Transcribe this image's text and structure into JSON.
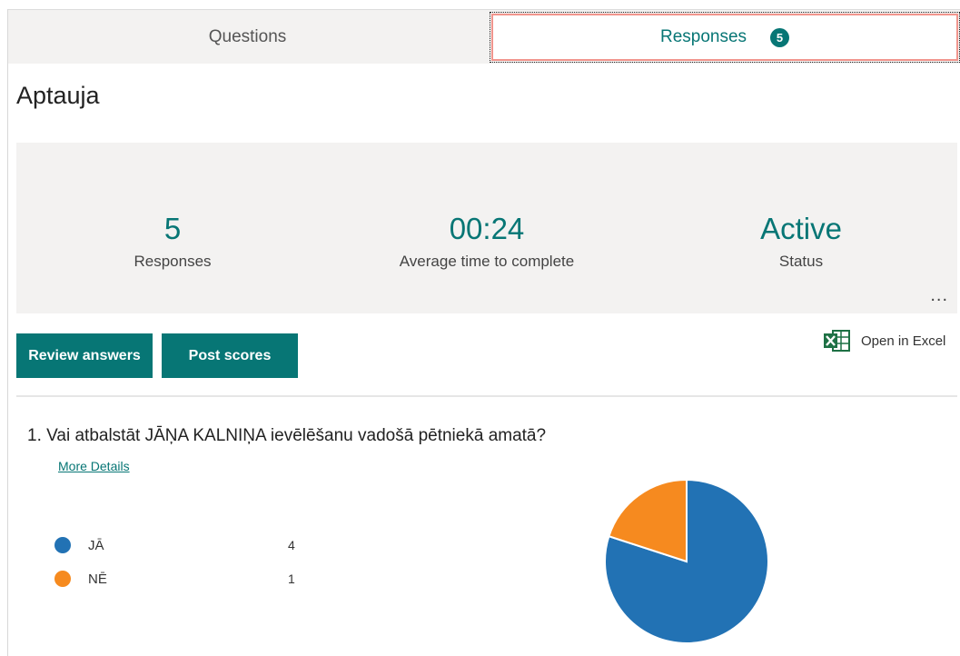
{
  "tabs": {
    "questions_label": "Questions",
    "responses_label": "Responses",
    "responses_badge": "5"
  },
  "form": {
    "title": "Aptauja"
  },
  "summary": {
    "responses": {
      "value": "5",
      "label": "Responses"
    },
    "avg_time": {
      "value": "00:24",
      "label": "Average time to complete"
    },
    "status": {
      "value": "Active",
      "label": "Status"
    },
    "more_label": "..."
  },
  "actions": {
    "review_label": "Review answers",
    "post_scores_label": "Post scores",
    "open_excel_label": "Open in Excel"
  },
  "question": {
    "number": "1.",
    "text": "Vai atbalstāt JĀŅA KALNIŅA ievēlēšanu vadošā pētniekā amatā?",
    "more_details": "More Details"
  },
  "chart_data": {
    "type": "pie",
    "categories": [
      "JĀ",
      "NĒ"
    ],
    "values": [
      4,
      1
    ],
    "colors": [
      "#2272b4",
      "#f68a1f"
    ]
  }
}
